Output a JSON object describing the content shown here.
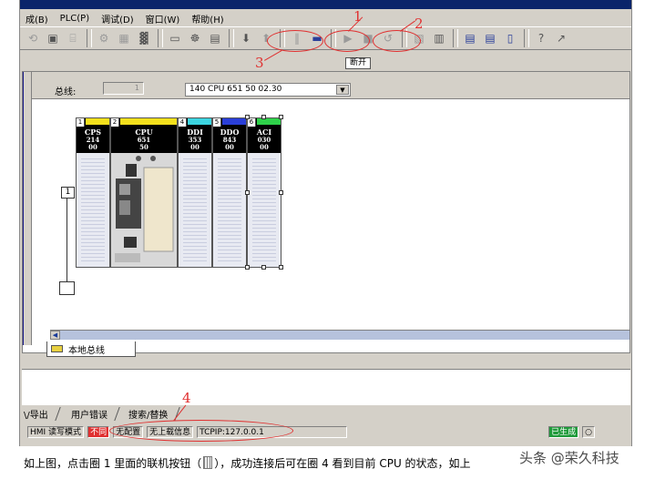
{
  "menu": [
    "成(B)",
    "PLC(P)",
    "调试(D)",
    "窗口(W)",
    "帮助(H)"
  ],
  "toolbar": {
    "disconnect_label": "断开"
  },
  "annotations": {
    "n1": "1",
    "n2": "2",
    "n3": "3",
    "n4": "4"
  },
  "bus": {
    "label": "总线:",
    "value": "1",
    "cpu_select": "140 CPU 651 50    02.30"
  },
  "rack": {
    "drop_number": "1",
    "modules": [
      {
        "slot": "1",
        "name": "CPS",
        "l2": "214",
        "l3": "00",
        "color": "#f4e01c"
      },
      {
        "slot": "2",
        "name": "CPU",
        "l2": "651",
        "l3": "50",
        "color": "#f4e01c"
      },
      {
        "slot": "4",
        "name": "DDI",
        "l2": "353",
        "l3": "00",
        "color": "#3cd4e0"
      },
      {
        "slot": "5",
        "name": "DDO",
        "l2": "843",
        "l3": "00",
        "color": "#2a3fd8"
      },
      {
        "slot": "6",
        "name": "ACI",
        "l2": "030",
        "l3": "00",
        "color": "#2ed14a"
      }
    ]
  },
  "tabs": {
    "local_bus": "本地总线"
  },
  "output_tabs": [
    "\\/导出",
    "用户错误",
    "搜索/替换"
  ],
  "status": {
    "hmi": "HMI 读写模式",
    "mismatch": "不同",
    "no_config": "无配置",
    "no_upload": "无上载信息",
    "tcpip": "TCPIP:127.0.0.1",
    "built": "已生成"
  },
  "colors": {
    "annotation": "#e03030",
    "mismatch": "#e03030",
    "built": "#1f9a3a"
  },
  "caption": {
    "before_icon": "如上图，点击圈 1 里面的联机按钮（",
    "after_icon": "），成功连接后可在圈 4 看到目前 CPU 的状态，如上"
  },
  "watermark": "头条 @荣久科技"
}
